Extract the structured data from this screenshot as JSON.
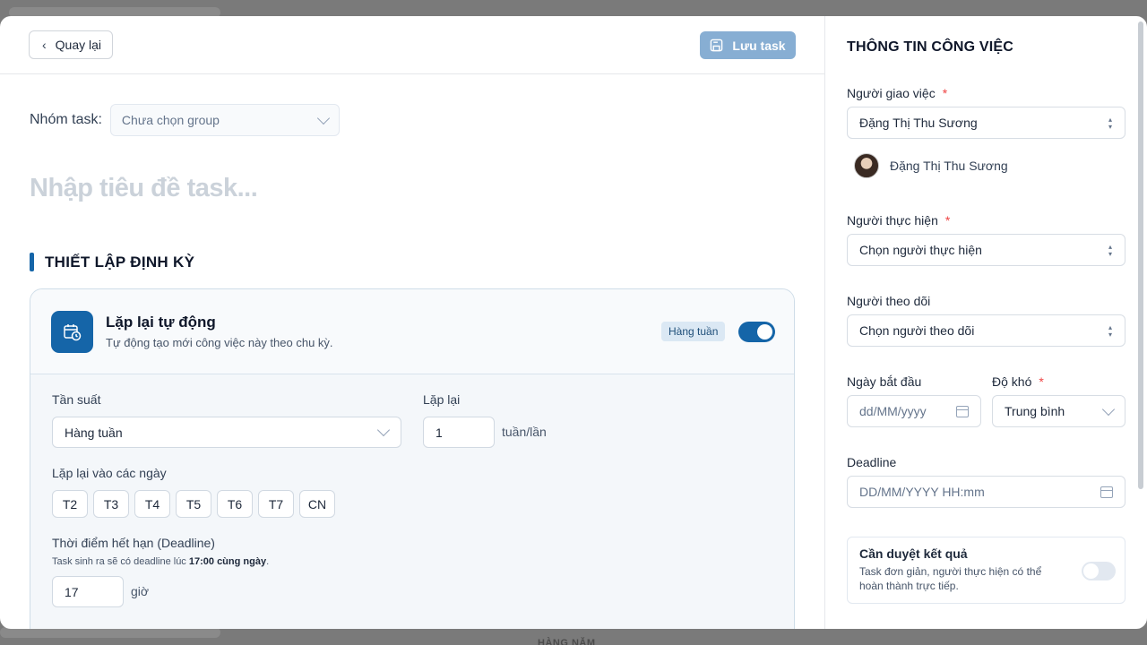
{
  "backdrop": {
    "footer_text": "HÀNG NĂM"
  },
  "header": {
    "back_label": "Quay lại",
    "save_label": "Lưu task"
  },
  "task": {
    "group_label": "Nhóm task:",
    "group_placeholder": "Chưa chọn group",
    "title_placeholder": "Nhập tiêu đề task..."
  },
  "recurrence": {
    "section_title": "THIẾT LẬP ĐỊNH KỲ",
    "title": "Lặp lại tự động",
    "subtitle": "Tự động tạo mới công việc này theo chu kỳ.",
    "badge": "Hàng tuần",
    "enabled": true,
    "frequency_label": "Tần suất",
    "frequency_value": "Hàng tuần",
    "repeat_label": "Lặp lại",
    "repeat_value": "1",
    "repeat_unit": "tuần/lần",
    "days_label": "Lặp lại vào các ngày",
    "days": [
      "T2",
      "T3",
      "T4",
      "T5",
      "T6",
      "T7",
      "CN"
    ],
    "deadline_label": "Thời điểm hết hạn (Deadline)",
    "deadline_note_prefix": "Task sinh ra sẽ có deadline lúc ",
    "deadline_note_time": "17:00 cùng ngày",
    "deadline_note_suffix": ".",
    "deadline_hour": "17",
    "hour_unit": "giờ"
  },
  "sidebar": {
    "title": "THÔNG TIN CÔNG VIỆC",
    "assigner_label": "Người giao việc",
    "assigner_value": "Đặng Thị Thu Sương",
    "assigner_chip": "Đặng Thị Thu Sương",
    "assignee_label": "Người thực hiện",
    "assignee_placeholder": "Chọn người thực hiện",
    "follower_label": "Người theo dõi",
    "follower_placeholder": "Chọn người theo dõi",
    "start_label": "Ngày bắt đầu",
    "start_placeholder": "dd/MM/yyyy",
    "difficulty_label": "Độ khó",
    "difficulty_value": "Trung bình",
    "deadline_label": "Deadline",
    "deadline_placeholder": "DD/MM/YYYY HH:mm",
    "approve_title": "Cần duyệt kết quả",
    "approve_desc": "Task đơn giản, người thực hiện có thể hoàn thành trực tiếp.",
    "approve_enabled": false,
    "required_mark": "*"
  },
  "colors": {
    "accent": "#1565a8",
    "save_button": "#87aed3",
    "required": "#ef4444"
  }
}
